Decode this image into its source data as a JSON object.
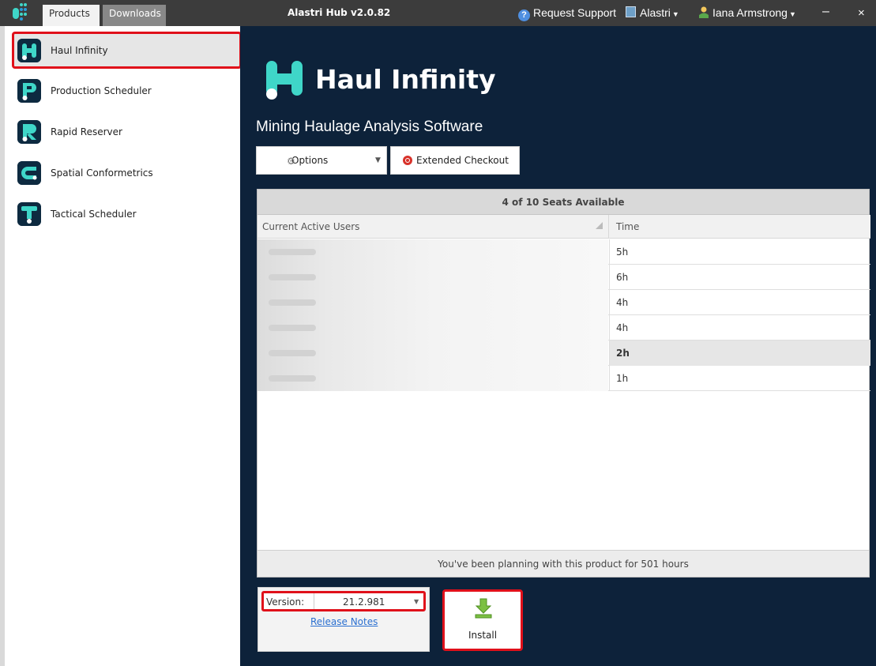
{
  "titlebar": {
    "tabs": [
      {
        "label": "Products"
      },
      {
        "label": "Downloads"
      }
    ],
    "app_title": "Alastri Hub v2.0.82",
    "request_support": "Request Support",
    "org": "Alastri",
    "user": "Iana Armstrong",
    "minimize": "–",
    "close": "×"
  },
  "sidebar": {
    "items": [
      {
        "label": "Haul Infinity",
        "icon": "h-logo-icon",
        "selected": true
      },
      {
        "label": "Production Scheduler",
        "icon": "p-logo-icon"
      },
      {
        "label": "Rapid Reserver",
        "icon": "r-logo-icon"
      },
      {
        "label": "Spatial Conformetrics",
        "icon": "c-logo-icon"
      },
      {
        "label": "Tactical Scheduler",
        "icon": "t-logo-icon"
      }
    ]
  },
  "product": {
    "title": "Haul Infinity",
    "subtitle": "Mining Haulage Analysis Software",
    "options_label": "Options",
    "extended_checkout_label": "Extended Checkout"
  },
  "seats": {
    "header": "4 of 10 Seats Available",
    "columns": [
      "Current Active Users",
      "Time"
    ],
    "rows": [
      {
        "user": "",
        "time": "5h"
      },
      {
        "user": "",
        "time": "6h"
      },
      {
        "user": "",
        "time": "4h"
      },
      {
        "user": "",
        "time": "4h"
      },
      {
        "user": "",
        "time": "2h"
      },
      {
        "user": "",
        "time": "1h"
      }
    ],
    "footer": "You've been planning with this product for 501 hours"
  },
  "version": {
    "label": "Version:",
    "value": "21.2.981",
    "release_notes": "Release Notes"
  },
  "install": {
    "label": "Install"
  },
  "colors": {
    "main_bg": "#0d223a",
    "accent_teal": "#3fd6c8",
    "highlight_red": "#e0101a"
  }
}
